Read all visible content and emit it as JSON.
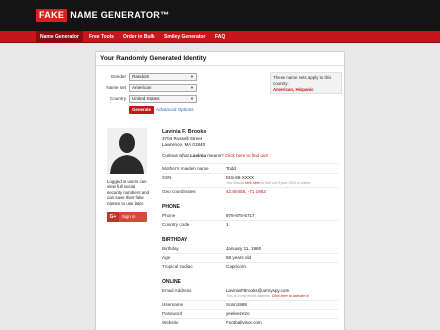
{
  "header": {
    "logo_fake": "FAKE",
    "logo_rest": "NAME GENERATOR™",
    "nav": [
      {
        "label": "Name Generator",
        "active": true
      },
      {
        "label": "Free Tools",
        "active": false
      },
      {
        "label": "Order in Bulk",
        "active": false
      },
      {
        "label": "Smiley Generator",
        "active": false
      },
      {
        "label": "FAQ",
        "active": false
      }
    ]
  },
  "panel": {
    "title": "Your Randomly Generated Identity",
    "form": {
      "gender_label": "Gender",
      "gender_value": "Random",
      "nameset_label": "Name set",
      "nameset_value": "American",
      "country_label": "Country",
      "country_value": "United States",
      "generate_label": "Generate",
      "advanced_label": "Advanced Options"
    },
    "notice": {
      "text": "These name sets apply to this country:",
      "highlight": "American, Hispanic"
    }
  },
  "sidebar": {
    "note": "Logged in users can view full social security numbers and can save their fake names to use later.",
    "gplus_icon": "G+",
    "gplus_label": "Sign in"
  },
  "identity": {
    "name": "Lavinia F. Brooks",
    "address_line1": "3704 Russell Street",
    "address_line2": "Lawrence, MA 01840",
    "curious_prefix": "Curious what ",
    "curious_name": "Lavinia",
    "curious_suffix": " means? ",
    "curious_link": "Click here to find out!",
    "mothers_maiden_label": "Mother's maiden name",
    "mothers_maiden_value": "Todd",
    "ssn_label": "SSN",
    "ssn_value": "015-66-XXXX",
    "ssn_sub_prefix": "You should ",
    "ssn_sub_link": "click here",
    "ssn_sub_suffix": " to find out if your SSN is online.",
    "geo_label": "Geo coordinates",
    "geo_value": "42.80455, -71.1953",
    "phone_section": "PHONE",
    "phone_label": "Phone",
    "phone_value": "978-975-5717",
    "country_code_label": "Country code",
    "country_code_value": "1",
    "birthday_section": "BIRTHDAY",
    "birthday_label": "Birthday",
    "birthday_value": "January 11, 1960",
    "age_label": "Age",
    "age_value": "58 years old",
    "zodiac_label": "Tropical zodiac",
    "zodiac_value": "Capricorn",
    "online_section": "ONLINE",
    "email_label": "Email Address",
    "email_value": "LaviniaFBrooks@armyspy.com",
    "email_sub_prefix": "This is a real email address. ",
    "email_sub_link": "Click here to activate it!",
    "username_label": "Username",
    "username_value": "Sonn1988",
    "password_label": "Password",
    "password_value": "yeeleeze2o",
    "website_label": "Website",
    "website_value": "Footballvisor.com"
  }
}
